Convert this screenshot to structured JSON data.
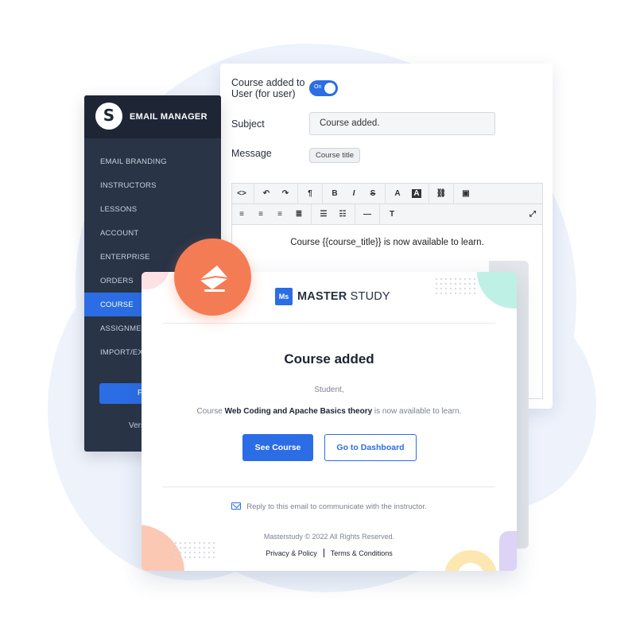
{
  "settings": {
    "notification_label": "Course added to User (for user)",
    "toggle_text": "On",
    "subject_label": "Subject",
    "subject_value": "Course added.",
    "message_label": "Message",
    "chip_label": "Course title",
    "editor_body": "Course {{course_title}} is now available to learn."
  },
  "sidebar": {
    "logo_letter": "S",
    "title": "EMAIL MANAGER",
    "items": [
      {
        "label": "EMAIL BRANDING"
      },
      {
        "label": "INSTRUCTORS"
      },
      {
        "label": "LESSONS"
      },
      {
        "label": "ACCOUNT"
      },
      {
        "label": "ENTERPRISE"
      },
      {
        "label": "ORDERS"
      },
      {
        "label": "COURSE"
      },
      {
        "label": "ASSIGNMENTS"
      },
      {
        "label": "IMPORT/EXPORT"
      }
    ],
    "active_item": "COURSE",
    "feedback_button": "Feedback",
    "version_text": "Version"
  },
  "email": {
    "brand_icon_text": "Ms",
    "brand_bold": "MASTER",
    "brand_rest": " STUDY",
    "title": "Course added",
    "greeting": "Student,",
    "line_prefix": "Course ",
    "course_name": "Web Coding and Apache Basics theory",
    "line_suffix": " is now available to learn.",
    "primary_button": "See Course",
    "secondary_button": "Go to Dashboard",
    "reply_text": "Reply to this email to communicate with the instructor.",
    "copyright": "Masterstudy © 2022 All Rights Reserved.",
    "privacy_link": "Privacy & Policy",
    "terms_link": "Terms & Conditions"
  },
  "colors": {
    "accent": "#2b6de4",
    "sidebar_bg": "#293446",
    "badge": "#f47c55"
  },
  "icons": {
    "badge": "envelope-icon",
    "reply": "mail-icon"
  }
}
